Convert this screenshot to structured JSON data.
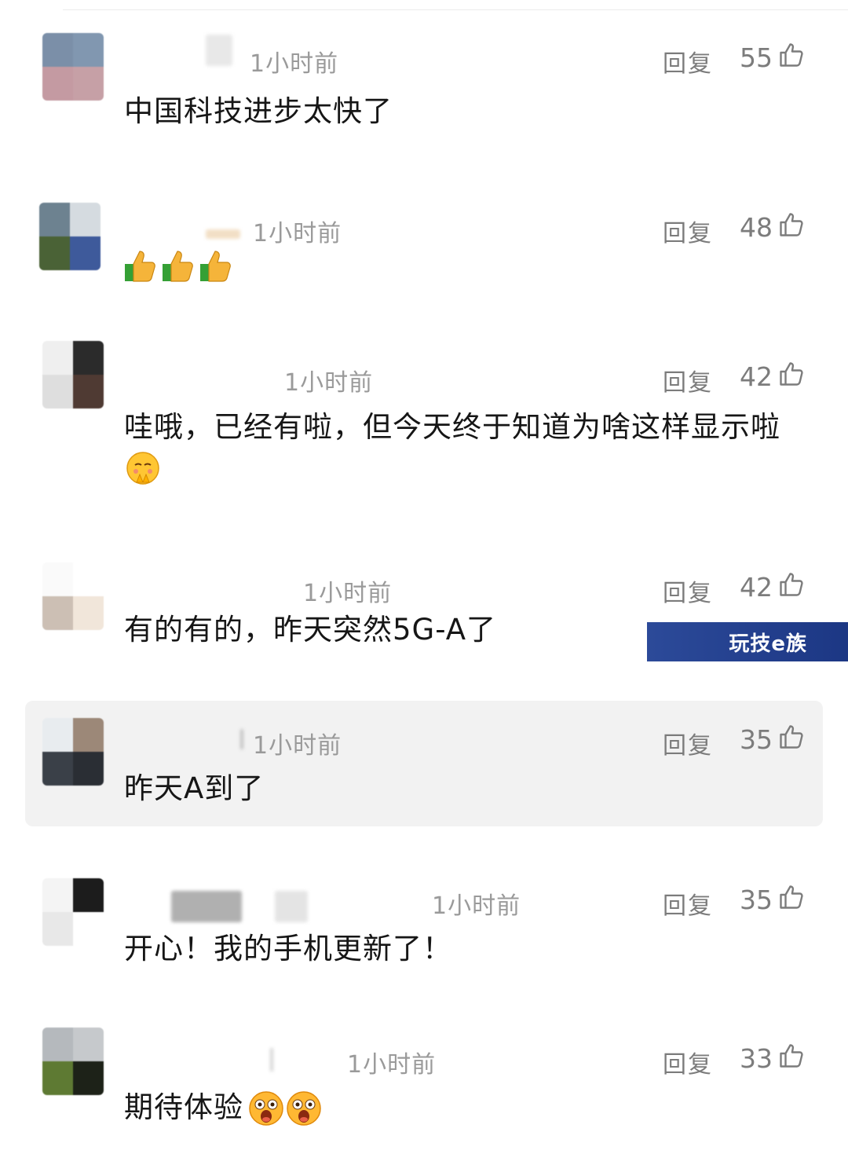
{
  "comments": [
    {
      "time": "1小时前",
      "reply": "回复",
      "likes": "55",
      "text": "中国科技进步太快了"
    },
    {
      "time": "1小时前",
      "reply": "回复",
      "likes": "48",
      "text": "",
      "emoji": [
        "thumbs-up",
        "thumbs-up",
        "thumbs-up"
      ]
    },
    {
      "time": "1小时前",
      "reply": "回复",
      "likes": "42",
      "text": "哇哦，已经有啦，但今天终于知道为啥这样显示啦",
      "emoji": [
        "shy-face"
      ]
    },
    {
      "time": "1小时前",
      "reply": "回复",
      "likes": "42",
      "text": "有的有的，昨天突然5G-A了"
    },
    {
      "time": "1小时前",
      "reply": "回复",
      "likes": "35",
      "text": "昨天A到了"
    },
    {
      "time": "1小时前",
      "reply": "回复",
      "likes": "35",
      "text": "开心！我的手机更新了！"
    },
    {
      "time": "1小时前",
      "reply": "回复",
      "likes": "33",
      "text": "期待体验",
      "emoji": [
        "surprised-face",
        "surprised-face"
      ]
    }
  ],
  "watermark": "玩技e族",
  "colors": {
    "highlight_bg": "#f2f2f2",
    "watermark_bg": "#1f3a8a",
    "meta_gray": "#9a9a9a"
  }
}
